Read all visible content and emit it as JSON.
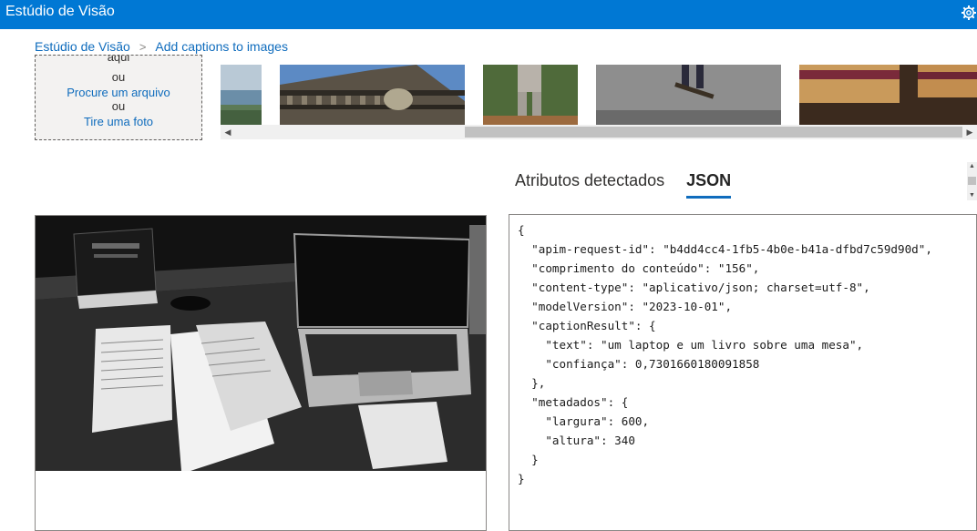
{
  "app": {
    "title": "Estúdio de Visão",
    "settings_icon": "gear-icon"
  },
  "breadcrumb": {
    "home": "Estúdio de Visão",
    "separator": ">",
    "current": "Add captions to images"
  },
  "upload": {
    "line1": "aqui",
    "or1": "ou",
    "browse": "Procure um arquivo",
    "or2": "ou",
    "photo": "Tire uma foto"
  },
  "tabs": [
    {
      "label": "Atributos detectados"
    },
    {
      "label": "JSON",
      "active": true
    }
  ],
  "json_lines": [
    "{",
    "  \"apim-request-id\": \"b4dd4cc4-1fb5-4b0e-b41a-dfbd7c59d90d\",",
    "  \"comprimento do conteúdo\": \"156\",",
    "  \"content-type\": \"aplicativo/json; charset=utf-8\",",
    "  \"modelVersion\": \"2023-10-01\",",
    "  \"captionResult\": {",
    "    \"text\": \"um laptop e um livro sobre uma mesa\",",
    "    \"confiança\": 0,7301660180091858",
    "  },",
    "  \"metadados\": {",
    "    \"largura\": 600,",
    "    \"altura\": 340",
    "  }",
    "}"
  ],
  "colors": {
    "brand": "#0078d4",
    "link": "#0f6cbd"
  }
}
